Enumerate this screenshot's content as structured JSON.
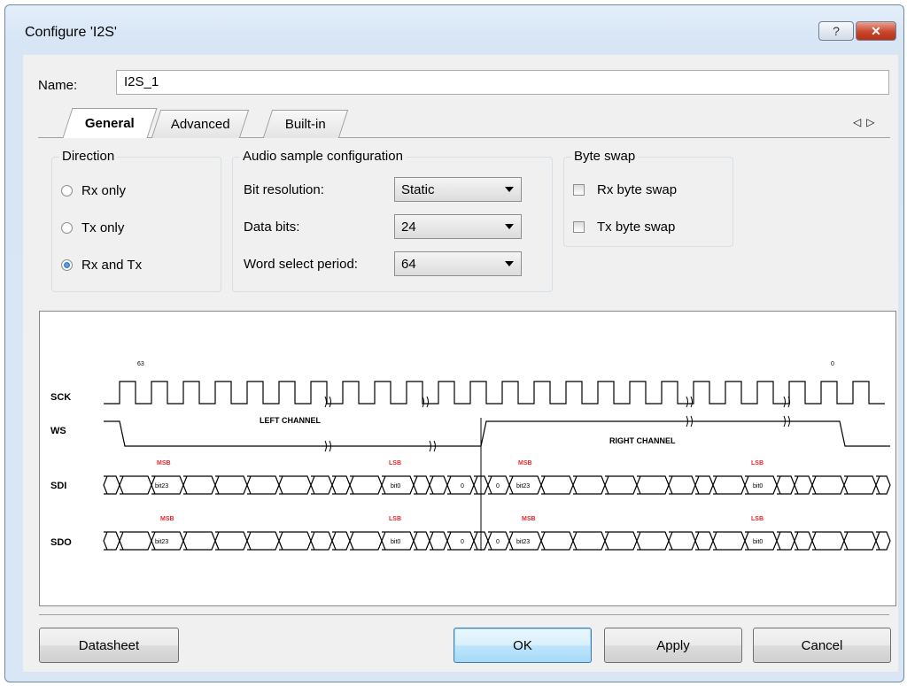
{
  "window": {
    "title": "Configure 'I2S'",
    "help_label": "?",
    "close_label": "✕"
  },
  "name": {
    "label": "Name:",
    "value": "I2S_1"
  },
  "tabs": [
    {
      "label": "General"
    },
    {
      "label": "Advanced"
    },
    {
      "label": "Built-in"
    }
  ],
  "tab_scroll": {
    "left_icon": "triangle-left-icon",
    "right_icon": "triangle-right-icon"
  },
  "direction": {
    "label": "Direction",
    "options": [
      {
        "label": "Rx only",
        "checked": false
      },
      {
        "label": "Tx only",
        "checked": false
      },
      {
        "label": "Rx and Tx",
        "checked": true
      }
    ]
  },
  "audio": {
    "label": "Audio sample configuration",
    "bit_resolution": {
      "label": "Bit resolution:",
      "value": "Static"
    },
    "data_bits": {
      "label": "Data bits:",
      "value": "24"
    },
    "word_select": {
      "label": "Word select period:",
      "value": "64"
    }
  },
  "byte_swap": {
    "label": "Byte swap",
    "rx": {
      "label": "Rx byte swap",
      "checked": false
    },
    "tx": {
      "label": "Tx byte swap",
      "checked": false
    }
  },
  "diagram": {
    "signals": [
      "SCK",
      "WS",
      "SDI",
      "SDO"
    ],
    "sck_start": "63",
    "sck_end": "0",
    "left_channel": "LEFT CHANNEL",
    "right_channel": "RIGHT CHANNEL",
    "msb": "MSB",
    "lsb": "LSB",
    "msb_bit": "bit23",
    "lsb_bit": "bit0",
    "zero": "0",
    "accent_color": "#e8262b"
  },
  "buttons": {
    "datasheet": "Datasheet",
    "ok": "OK",
    "apply": "Apply",
    "cancel": "Cancel"
  }
}
